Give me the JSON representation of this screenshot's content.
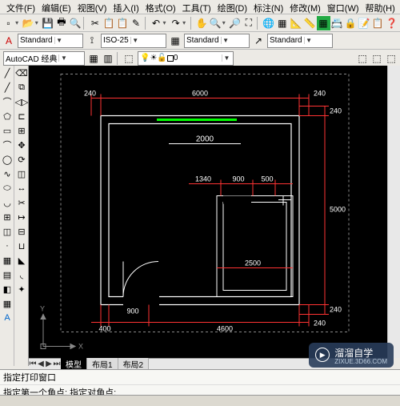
{
  "menubar": {
    "items": [
      "文件(F)",
      "编辑(E)",
      "视图(V)",
      "插入(I)",
      "格式(O)",
      "工具(T)",
      "绘图(D)",
      "标注(N)",
      "修改(M)",
      "窗口(W)",
      "帮助(H)"
    ]
  },
  "toolbar1": {
    "icons": [
      "📄",
      "📂",
      "💾",
      "🖶",
      "🔍",
      "✂",
      "📋",
      "📋",
      "↶",
      "↷",
      "🔗",
      "🔍",
      "🔍",
      "🔍",
      "🌐",
      "📊",
      "📐",
      "📏",
      "🧮",
      "📇",
      "🔒",
      "📝",
      "📋",
      "❓"
    ]
  },
  "toolbar2": {
    "layer_combo": "Standard",
    "dim_combo": "ISO-25",
    "text_combo": "Standard",
    "style_combo": "Standard"
  },
  "toolbar3": {
    "workspace": "AutoCAD 经典",
    "layer0": "0"
  },
  "side1": [
    "╱",
    "╱",
    "⌒",
    "⌖",
    "⬭",
    "◻",
    "◯",
    "∿",
    "⬡",
    "◯",
    "A",
    "⬚",
    "◫",
    "▦",
    "◧",
    "·",
    "⬛",
    "◆"
  ],
  "side2": [
    "⬀",
    "⧉",
    "⟲",
    "△",
    "⊞",
    "✂",
    "↔",
    "⟳",
    "▣",
    "◫",
    "⊡",
    "⬚",
    "⬚",
    "□",
    "↘",
    "⤴",
    "✕",
    "⬚"
  ],
  "tabs": {
    "model": "模型",
    "layout1": "布局1",
    "layout2": "布局2"
  },
  "axis": {
    "x": "X",
    "y": "Y"
  },
  "cmd": {
    "line1": "指定打印窗口",
    "line2": "指定第一个角点: 指定对角点:"
  },
  "watermark": {
    "title": "溜溜自学",
    "sub": "ZIXUE.3D66.COM"
  },
  "dims": {
    "d240a": "240",
    "d6000": "6000",
    "d240b": "240",
    "d240c": "240",
    "d2000": "2000",
    "d1340": "1340",
    "d900a": "900",
    "d500": "500",
    "d5000": "5000",
    "d2500": "2500",
    "d240d": "240",
    "d900b": "900",
    "d400": "400",
    "d4600": "4600",
    "d240e": "240"
  }
}
